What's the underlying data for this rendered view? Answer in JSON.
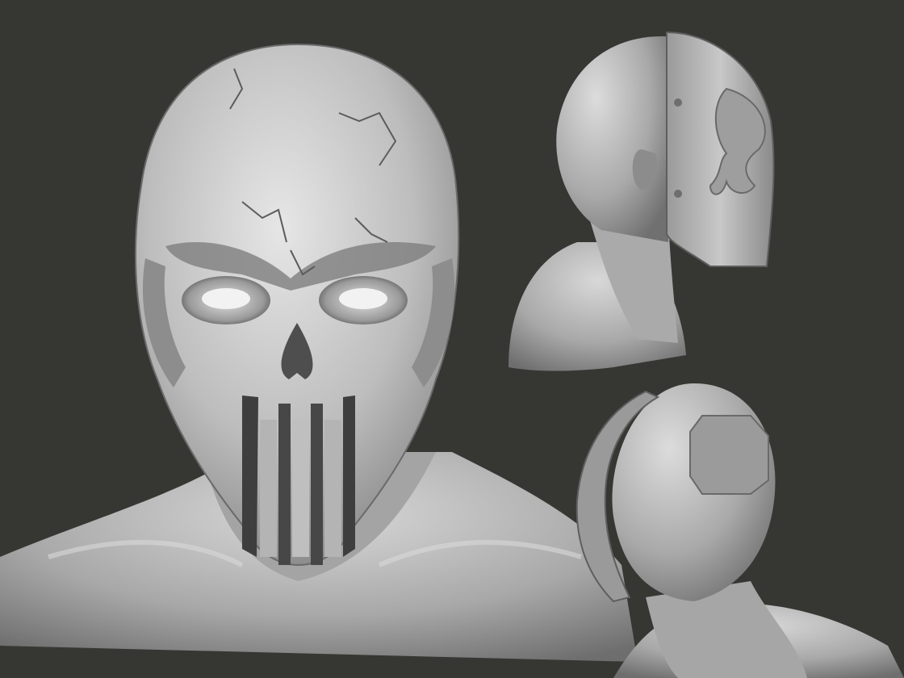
{
  "scene": {
    "background_color": "#363732",
    "clay_color": "#b9b9b9",
    "views": [
      {
        "name": "front-view",
        "subject": "skull-mask-bust"
      },
      {
        "name": "side-view",
        "subject": "skull-mask-bust"
      },
      {
        "name": "back-view",
        "subject": "skull-mask-bust"
      }
    ]
  }
}
